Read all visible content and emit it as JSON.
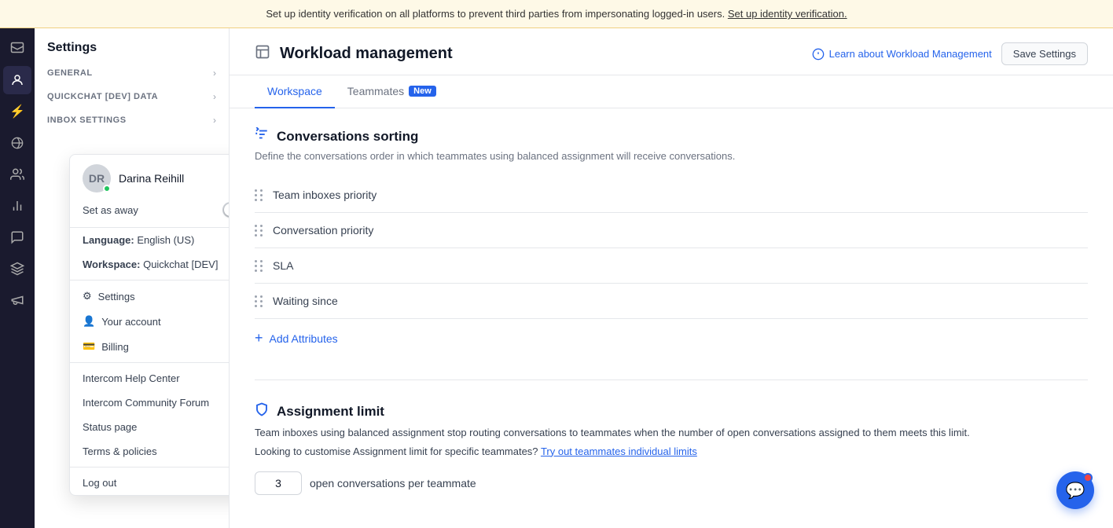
{
  "banner": {
    "text": "Set up identity verification on all platforms to prevent third parties from impersonating logged-in users.",
    "link_text": "Set up identity verification."
  },
  "sidebar": {
    "settings_label": "Settings",
    "sections": [
      {
        "id": "general",
        "label": "GENERAL",
        "has_chevron": true
      },
      {
        "id": "quickchat",
        "label": "QUICKCHAT [DEV] DATA",
        "has_chevron": true
      },
      {
        "id": "inbox",
        "label": "INBOX SETTINGS",
        "has_chevron": true
      }
    ]
  },
  "user_dropdown": {
    "name": "Darina Reihill",
    "set_away_label": "Set as away",
    "language_label": "Language:",
    "language_value": "English (US)",
    "workspace_label": "Workspace:",
    "workspace_value": "Quickchat [DEV]",
    "settings_label": "Settings",
    "your_account_label": "Your account",
    "billing_label": "Billing",
    "help_center_label": "Intercom Help Center",
    "community_label": "Intercom Community Forum",
    "status_label": "Status page",
    "terms_label": "Terms & policies",
    "logout_label": "Log out"
  },
  "header": {
    "icon": "⊞",
    "title": "Workload management",
    "learn_label": "Learn about Workload Management",
    "save_label": "Save Settings"
  },
  "tabs": [
    {
      "id": "workspace",
      "label": "Workspace",
      "active": true
    },
    {
      "id": "teammates",
      "label": "Teammates",
      "badge": "New",
      "active": false
    }
  ],
  "conversations_sorting": {
    "title": "Conversations sorting",
    "description": "Define the conversations order in which teammates using balanced assignment will receive conversations.",
    "items": [
      {
        "id": "team-inboxes",
        "label": "Team inboxes priority"
      },
      {
        "id": "conversation",
        "label": "Conversation priority"
      },
      {
        "id": "sla",
        "label": "SLA"
      },
      {
        "id": "waiting",
        "label": "Waiting since"
      }
    ],
    "add_label": "Add Attributes"
  },
  "assignment_limit": {
    "title": "Assignment limit",
    "desc1": "Team inboxes using balanced assignment stop routing conversations to teammates when the number of open conversations assigned to them meets this limit.",
    "desc2": "Looking to customise Assignment limit for specific teammates?",
    "link_text": "Try out teammates individual limits",
    "input_value": "3",
    "input_suffix": "open conversations per teammate"
  }
}
